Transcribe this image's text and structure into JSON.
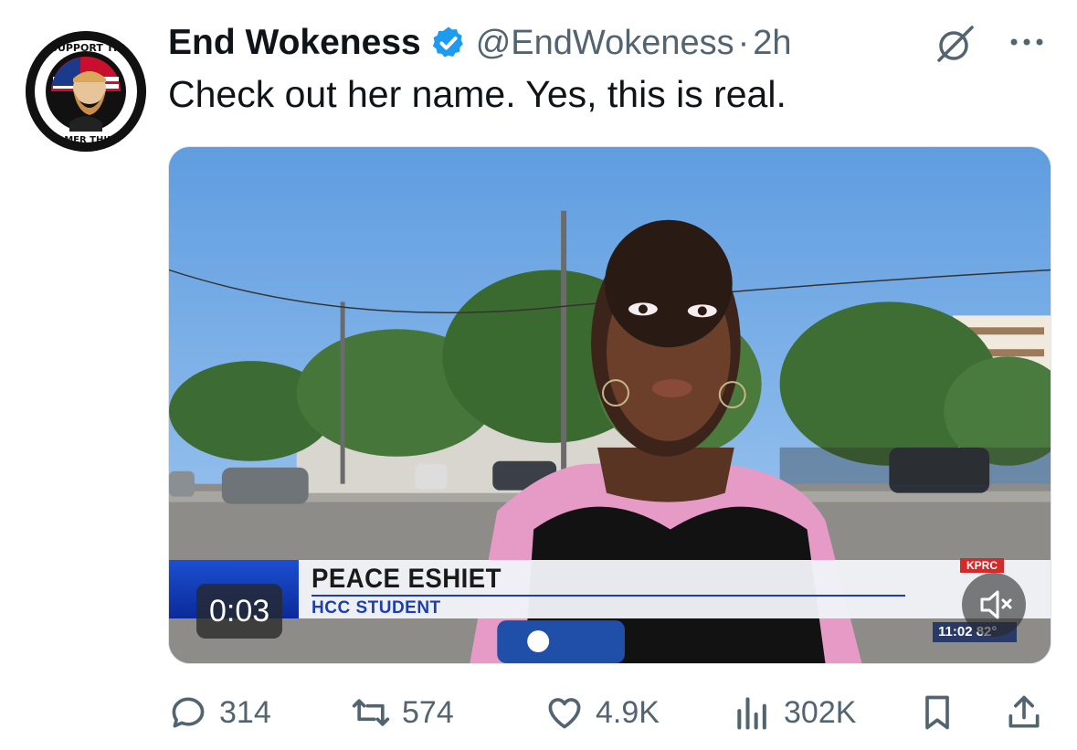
{
  "tweet": {
    "display_name": "End Wokeness",
    "handle": "@EndWokeness",
    "separator": "·",
    "time": "2h",
    "text": "Check out her name. Yes, this is real.",
    "verified": true,
    "avatar_text_top": "I SUPPORT THE",
    "avatar_text_bottom": "FORMER THINGS"
  },
  "media": {
    "timestamp": "0:03",
    "lower_third_name": "PEACE ESHIET",
    "lower_third_title": "HCC STUDENT",
    "station": "KPRC",
    "clock": "11:02  82°",
    "muted": true
  },
  "actions": {
    "replies": "314",
    "reposts": "574",
    "likes": "4.9K",
    "views": "302K"
  },
  "icons": {
    "reply": "reply-icon",
    "repost": "repost-icon",
    "like": "heart-icon",
    "views": "views-icon",
    "bookmark": "bookmark-icon",
    "share": "share-icon",
    "grok": "grok-icon",
    "more": "more-icon",
    "mute": "mute-icon"
  },
  "colors": {
    "verified": "#1d9bf0",
    "secondary_text": "#536471",
    "primary_text": "#0f1419"
  }
}
